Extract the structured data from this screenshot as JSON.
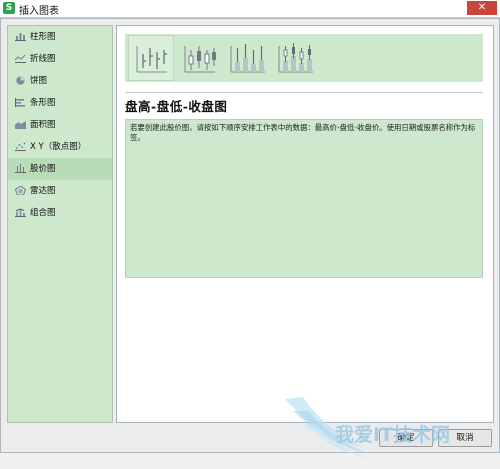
{
  "window": {
    "title": "插入图表",
    "app_icon_letter": "S",
    "close_glyph": "✕"
  },
  "sidebar": {
    "items": [
      {
        "label": "柱形图",
        "icon": "column-chart-icon"
      },
      {
        "label": "折线图",
        "icon": "line-chart-icon"
      },
      {
        "label": "饼图",
        "icon": "pie-chart-icon"
      },
      {
        "label": "条形图",
        "icon": "bar-chart-icon"
      },
      {
        "label": "面积图",
        "icon": "area-chart-icon"
      },
      {
        "label": "X Y（散点图）",
        "icon": "scatter-chart-icon"
      },
      {
        "label": "股价图",
        "icon": "stock-chart-icon"
      },
      {
        "label": "雷达图",
        "icon": "radar-chart-icon"
      },
      {
        "label": "组合图",
        "icon": "combo-chart-icon"
      }
    ],
    "selected_index": 6
  },
  "main": {
    "chart_title": "盘高-盘低-收盘图",
    "description": "若要创建此股价图，请按如下顺序安排工作表中的数据：最高价-盘低-收盘价。使用日期或股票名称作为标签。",
    "thumbnails": [
      "stock-hlc-icon",
      "stock-ohlc-icon",
      "stock-vhlc-icon",
      "stock-vohlc-icon"
    ],
    "selected_thumbnail": 0
  },
  "buttons": {
    "ok_label": "确定",
    "cancel_label": "取消"
  },
  "watermark": {
    "text": "我爱IT技术网"
  },
  "colors": {
    "panel_green": "#cde8cd",
    "selected_green": "#b8dbb8",
    "close_red": "#c9463d",
    "brand_green": "#2aa34a"
  }
}
